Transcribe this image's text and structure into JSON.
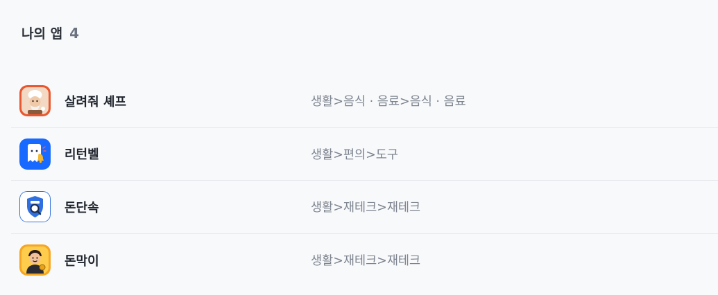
{
  "header": {
    "title": "나의 앱",
    "count": "4"
  },
  "apps": [
    {
      "name": "살려줘 셰프",
      "category": "생활>음식 · 음료>음식 · 음료",
      "icon": "chef-app-icon"
    },
    {
      "name": "리턴벨",
      "category": "생활>편의>도구",
      "icon": "returnbell-app-icon"
    },
    {
      "name": "돈단속",
      "category": "생활>재테크>재테크",
      "icon": "dondansok-app-icon"
    },
    {
      "name": "돈막이",
      "category": "생활>재테크>재테크",
      "icon": "donmagi-app-icon"
    }
  ]
}
